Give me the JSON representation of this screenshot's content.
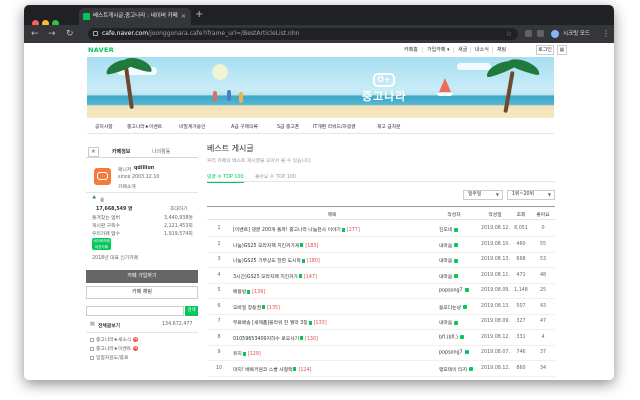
{
  "browser": {
    "tab_title": "베스트게시글,중고나라 : 네이버 카페",
    "url_host": "cafe.naver.com",
    "url_path": "/joonggonara.cafe?iframe_url=/BestArticleList.nhn",
    "profile_label": "시크릿 모드"
  },
  "gnb": {
    "logo": "NAVER",
    "links": [
      "카페홈",
      "가입카페 ▾",
      "새글",
      "내소식",
      "채팅"
    ],
    "login": "로그인"
  },
  "banner": {
    "title": "중고나라",
    "logo_glyph": "O+"
  },
  "submenu": [
    "공지사항",
    "중고나라★이벤트",
    "비밀계가용안",
    "A급 구제의류",
    "S급 중고폰",
    "IT개편 리워드/자랑글",
    "재고 급처분"
  ],
  "left": {
    "tab_info": "카페정보",
    "tab_my": "나의활동",
    "cafe_manager_label": "매니저",
    "cafe_manager_name": "qdillion",
    "since": "since 2003.12.10",
    "cafe_intro": "카페소개",
    "level_label": "숲",
    "members": "17,668,549 명",
    "invite": "초대하기",
    "stat_rows": [
      {
        "label": "즐겨찾는 멤버",
        "value": "3,440,938명"
      },
      {
        "label": "게시판 구독수",
        "value": "2,121,453회"
      },
      {
        "label": "우리카페 앱수",
        "value": "1,919,574회"
      }
    ],
    "badge_text": "네이버카페 대표카페",
    "award_text": "2018년 대표 인기카페",
    "join_button": "카페 가입하기",
    "chat_button": "카페 채팅",
    "search_button": "검색",
    "all_posts_label": "전체글보기",
    "all_posts_count": "134,672,477",
    "boards": [
      "중고나라★새소식",
      "중고나라★이벤트",
      "입점지원도/종료"
    ]
  },
  "main": {
    "title": "베스트 게시글",
    "subtitle": "우리 카페의 베스트 게시글을 모아서 볼 수 있습니다.",
    "tab_comments": "댓글 수 TOP 100",
    "tab_likes": "좋아요 수 TOP 100",
    "period_select": "일주일",
    "range_select": "1위~20위",
    "headers": {
      "title": "제목",
      "author": "작성자",
      "date": "작성일",
      "views": "조회",
      "likes": "좋아요"
    },
    "rows": [
      {
        "rank": "1",
        "title": "[이벤트] 댓글 200개 돌파! 중고나라 나눔천사 이야기",
        "count": "[277]",
        "author": "진모네",
        "date": "2019.08.12.",
        "views": "8,051",
        "likes": "0",
        "new": false
      },
      {
        "rank": "2",
        "title": "나눔)GS25 모라지팩 치킨커가게",
        "count": "[183]",
        "author": "내마음",
        "date": "2019.08.10.",
        "views": "460",
        "likes": "55",
        "new": false
      },
      {
        "rank": "3",
        "title": "나눔)GS25 기부상도 한한 도시락",
        "count": "[180]",
        "author": "내마음",
        "date": "2019.08.13.",
        "views": "668",
        "likes": "53",
        "new": false
      },
      {
        "rank": "4",
        "title": "3시간)GS25 모라지팩 치킨커가",
        "count": "[147]",
        "author": "내마음",
        "date": "2019.08.11.",
        "views": "471",
        "likes": "48",
        "new": false
      },
      {
        "rank": "5",
        "title": "배몽방",
        "count": "[139]",
        "author": "popsong7",
        "date": "2019.08.09.",
        "views": "1,148",
        "likes": "25",
        "new": false
      },
      {
        "rank": "6",
        "title": "모바일 창동권",
        "count": "[135]",
        "author": "용포다는냥",
        "date": "2019.08.13.",
        "views": "507",
        "likes": "43",
        "new": true
      },
      {
        "rank": "7",
        "title": "무료배송 [새제품]플라워 한 월악 3칭",
        "count": "[133]",
        "author": "내마음",
        "date": "2019.08.09.",
        "views": "327",
        "likes": "47",
        "new": false
      },
      {
        "rank": "8",
        "title": "01059653409지하수 로오사기",
        "count": "[130]",
        "author": "bfl.(bfl.)",
        "date": "2019.08.12.",
        "views": "331",
        "likes": "4",
        "new": true
      },
      {
        "rank": "9",
        "title": "유지",
        "count": "[129]",
        "author": "popsong7",
        "date": "2019.08.07.",
        "views": "746",
        "likes": "37",
        "new": false
      },
      {
        "rank": "10",
        "title": "마지! 배복키원코 스쿨 사형맥",
        "count": "[124]",
        "author": "맹모테이 타지",
        "date": "2019.08.12.",
        "views": "860",
        "likes": "34",
        "new": false
      }
    ]
  },
  "colors": {
    "naver_green": "#03c75a",
    "comment_red": "#e04b4b",
    "chrome_dark": "#202124"
  }
}
